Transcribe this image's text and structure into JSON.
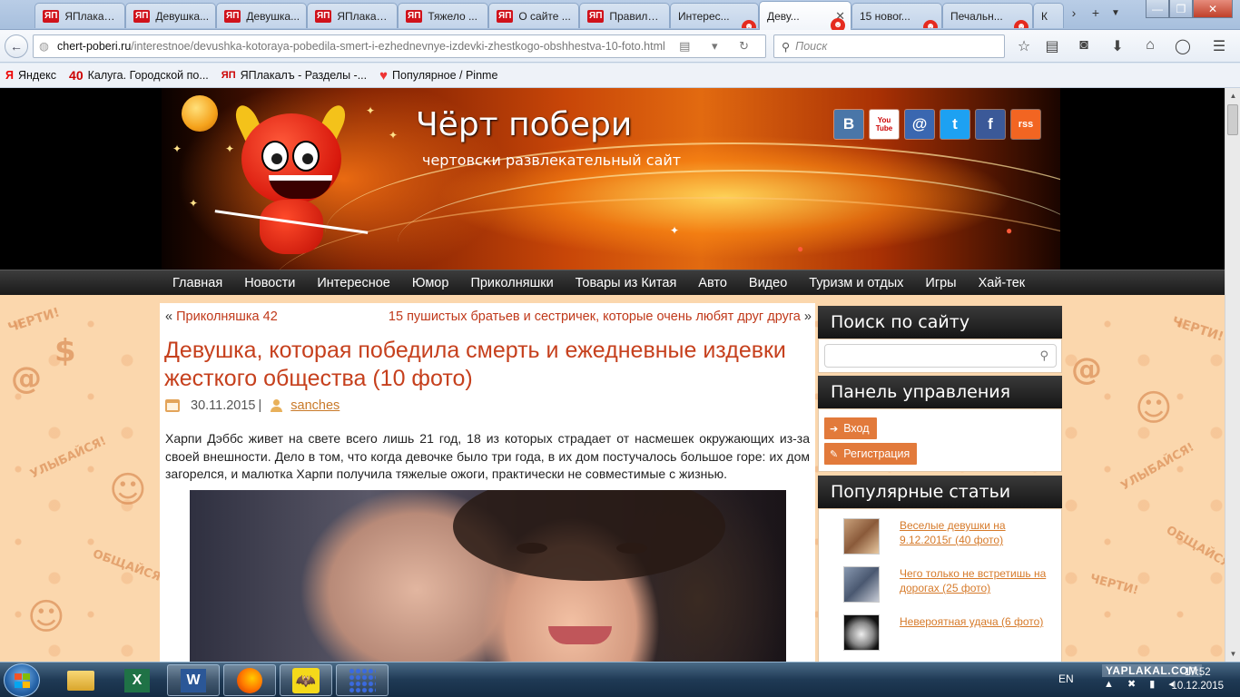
{
  "browser": {
    "tabs": [
      {
        "title": "ЯПлакал...",
        "favicon": "ЯП"
      },
      {
        "title": "Девушка...",
        "favicon": "ЯП"
      },
      {
        "title": "Девушка...",
        "favicon": "ЯП"
      },
      {
        "title": "ЯПлакал...",
        "favicon": "ЯП"
      },
      {
        "title": "Тяжело ...",
        "favicon": "ЯП"
      },
      {
        "title": "О сайте ...",
        "favicon": "ЯП"
      },
      {
        "title": "Правила ...",
        "favicon": "ЯП"
      },
      {
        "title": "Интерес...",
        "favicon": "devil"
      },
      {
        "title": "Деву...",
        "favicon": "devil",
        "active": true
      },
      {
        "title": "15 новог...",
        "favicon": "devil"
      },
      {
        "title": "Печальн...",
        "favicon": "devil"
      },
      {
        "title": "К",
        "favicon": "devil"
      }
    ],
    "url_host": "chert-poberi.ru",
    "url_path": "/interestnoe/devushka-kotoraya-pobedila-smert-i-ezhednevnye-izdevki-zhestkogo-obshhestva-10-foto.html",
    "search_placeholder": "Поиск",
    "bookmarks": [
      {
        "icon": "Я",
        "label": "Яндекс"
      },
      {
        "icon": "40",
        "label": "Калуга. Городской по..."
      },
      {
        "icon": "ЯП",
        "label": "ЯПлакалъ - Разделы -..."
      },
      {
        "icon": "♥",
        "label": "Популярное / Pinme"
      }
    ]
  },
  "site": {
    "title": "Чёрт побери",
    "subtitle": "чертовски развлекательный сайт",
    "social": [
      {
        "label": "В",
        "color": "#4a76a8"
      },
      {
        "label": "You Tube",
        "color": "#ffffff"
      },
      {
        "label": "@",
        "color": "#3a67b0"
      },
      {
        "label": "t",
        "color": "#1da1f2"
      },
      {
        "label": "f",
        "color": "#3b5998"
      },
      {
        "label": "rss",
        "color": "#f26522"
      }
    ],
    "menu": [
      "Главная",
      "Новости",
      "Интересное",
      "Юмор",
      "Приколняшки",
      "Товары из Китая",
      "Авто",
      "Видео",
      "Туризм и отдых",
      "Игры",
      "Хай-тек"
    ]
  },
  "post": {
    "prev_arrow": "«",
    "prev": "Приколняшка 42",
    "next": "15 пушистых братьев и сестричек, которые очень любят друг друга",
    "next_arrow": "»",
    "title": "Девушка, которая победила смерть и ежедневные издевки жесткого общества (10 фото)",
    "date": "30.11.2015",
    "separator": "|",
    "author": "sanches",
    "text": "Харпи Дэббс живет на свете всего лишь 21 год, 18 из которых страдает от насмешек окружающих из-за своей внешности. Дело в том, что когда девочке было три года, в их дом постучалось большое горе: их дом загорелся, и малютка Харпи получила тяжелые ожоги, практически не совместимые с жизнью."
  },
  "sidebar": {
    "search_title": "Поиск по сайту",
    "panel_title": "Панель управления",
    "login": "Вход",
    "register": "Регистрация",
    "popular_title": "Популярные статьи",
    "popular": [
      "Веселые девушки на 9.12.2015г (40 фото)",
      "Чего только не встретишь на дорогах (25 фото)",
      "Невероятная удача (6 фото)"
    ]
  },
  "taskbar": {
    "lang": "EN",
    "watermark": "YAPLAKAL.COM",
    "time": "17:52",
    "date": "10.12.2015",
    "apps": [
      "explorer",
      "excel",
      "word",
      "firefox",
      "batman",
      "app"
    ]
  }
}
